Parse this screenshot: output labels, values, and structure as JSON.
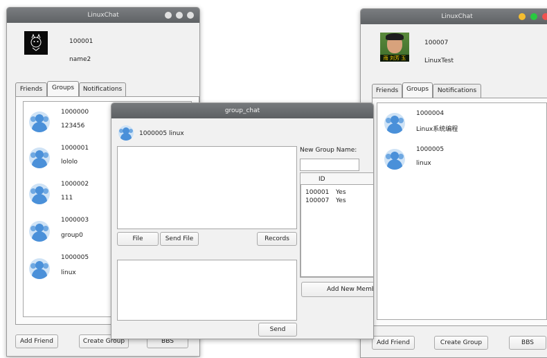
{
  "win_left": {
    "title": "LinuxChat",
    "user_id": "100001",
    "user_name": "name2",
    "tabs": [
      "Friends",
      "Groups",
      "Notifications"
    ],
    "groups": [
      {
        "id": "1000000",
        "name": "123456"
      },
      {
        "id": "1000001",
        "name": "lololo"
      },
      {
        "id": "1000002",
        "name": "111"
      },
      {
        "id": "1000003",
        "name": "group0"
      },
      {
        "id": "1000005",
        "name": "linux"
      }
    ],
    "add_friend": "Add Friend",
    "create_group": "Create Group",
    "bbs": "BBS"
  },
  "win_right": {
    "title": "LinuxChat",
    "user_id": "100007",
    "user_name": "LinuxTest",
    "avatar_caption": "雨 刘芳 玉",
    "tabs": [
      "Friends",
      "Groups",
      "Notifications"
    ],
    "groups": [
      {
        "id": "1000004",
        "name": "Linux系统编程"
      },
      {
        "id": "1000005",
        "name": "linux"
      }
    ],
    "add_friend": "Add Friend",
    "create_group": "Create Group",
    "bbs": "BBS"
  },
  "group_chat": {
    "title": "group_chat",
    "header": "1000005  linux",
    "file": "File",
    "send_file": "Send File",
    "records": "Records",
    "send": "Send",
    "new_group_name_label": "New Group Name:",
    "new_group_name_value": "",
    "id_header": "ID",
    "members": [
      {
        "id": "100001",
        "status": "Yes"
      },
      {
        "id": "100007",
        "status": "Yes"
      }
    ],
    "add_new_member": "Add New Member"
  },
  "colors": {
    "titlebar": "#6b6e71",
    "close_red": "#f0524f",
    "min_yellow": "#f5bd2f",
    "max_green": "#29c940",
    "avatar_blue": "#4a90d9"
  }
}
